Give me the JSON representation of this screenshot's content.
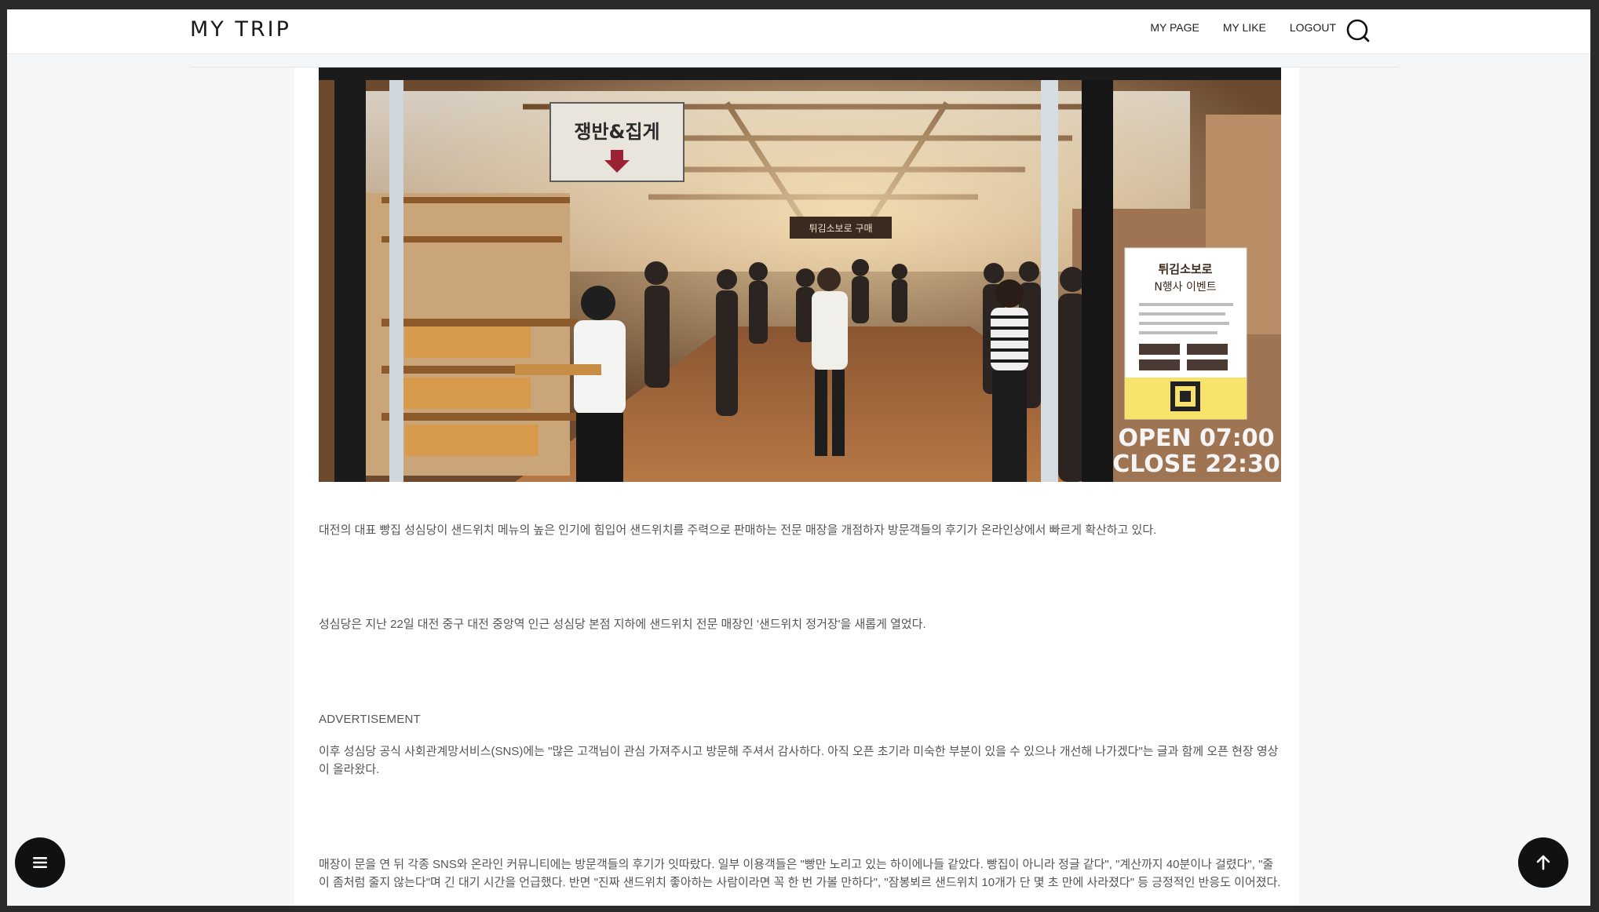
{
  "header": {
    "logo": "MY TRIP",
    "nav": [
      {
        "label": "MY PAGE"
      },
      {
        "label": "MY LIKE"
      },
      {
        "label": "LOGOUT"
      }
    ]
  },
  "hero": {
    "sign_top": "쟁반&집게",
    "sign_banner": "튀김소보로 구매",
    "poster_title": "튀김소보로",
    "poster_subtitle": "N행사 이벤트",
    "hours_open": "OPEN 07:00",
    "hours_close": "CLOSE 22:30"
  },
  "article": {
    "p1": "대전의 대표 빵집 성심당이 샌드위치 메뉴의 높은 인기에 힘입어 샌드위치를 주력으로 판매하는 전문 매장을 개점하자 방문객들의 후기가 온라인상에서 빠르게 확산하고 있다.",
    "p2": "성심당은 지난 22일 대전 중구 대전 중앙역 인근 성심당 본점 지하에 샌드위치 전문 매장인 '샌드위치 정거장'을 새롭게 열었다.",
    "ad_label": "ADVERTISEMENT",
    "p3": "이후 성심당 공식 사회관계망서비스(SNS)에는 \"많은 고객님이 관심 가져주시고 방문해 주셔서 감사하다. 아직 오픈 초기라 미숙한 부분이 있을 수 있으나 개선해 나가겠다\"는 글과 함께 오픈 현장 영상이 올라왔다.",
    "p4": "매장이 문을 연 뒤 각종 SNS와 온라인 커뮤니티에는 방문객들의 후기가 잇따랐다. 일부 이용객들은 \"빵만 노리고 있는 하이에나들 같았다. 빵집이 아니라 정글 같다\", \"계산까지 40분이나 걸렸다\", \"줄이 좀처럼 줄지 않는다\"며 긴 대기 시간을 언급했다. 반면 \"진짜 샌드위치 좋아하는 사람이라면 꼭 한 번 가볼 만하다\", \"잠봉뵈르 샌드위치 10개가 단 몇 초 만에 사라졌다\" 등 긍정적인 반응도 이어졌다."
  },
  "colors": {
    "accent": "#111111",
    "text": "#555555",
    "page_bg": "#f5f6f8"
  },
  "icons": {
    "search": "search-icon",
    "menu": "hamburger-icon",
    "top": "arrow-up-icon"
  }
}
